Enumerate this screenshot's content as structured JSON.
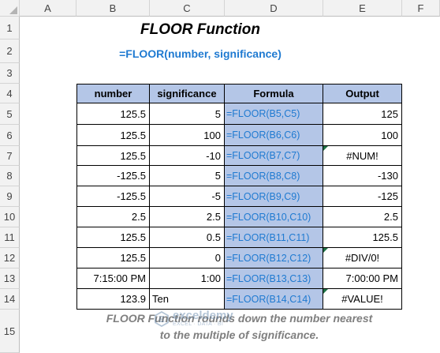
{
  "columns": [
    "A",
    "B",
    "C",
    "D",
    "E",
    "F"
  ],
  "rows": [
    "1",
    "2",
    "3",
    "4",
    "5",
    "6",
    "7",
    "8",
    "9",
    "10",
    "11",
    "12",
    "13",
    "14",
    "15"
  ],
  "title": "FLOOR Function",
  "syntax": "=FLOOR(number, significance)",
  "table": {
    "headers": [
      "number",
      "significance",
      "Formula",
      "Output"
    ],
    "rows": [
      [
        "125.5",
        "5",
        "=FLOOR(B5,C5)",
        "125"
      ],
      [
        "125.5",
        "100",
        "=FLOOR(B6,C6)",
        "100"
      ],
      [
        "125.5",
        "-10",
        "=FLOOR(B7,C7)",
        "#NUM!"
      ],
      [
        "-125.5",
        "5",
        "=FLOOR(B8,C8)",
        "-130"
      ],
      [
        "-125.5",
        "-5",
        "=FLOOR(B9,C9)",
        "-125"
      ],
      [
        "2.5",
        "2.5",
        "=FLOOR(B10,C10)",
        "2.5"
      ],
      [
        "125.5",
        "0.5",
        "=FLOOR(B11,C11)",
        "125.5"
      ],
      [
        "125.5",
        "0",
        "=FLOOR(B12,C12)",
        "#DIV/0!"
      ],
      [
        "7:15:00 PM",
        "1:00",
        "=FLOOR(B13,C13)",
        "7:00:00 PM"
      ],
      [
        "123.9",
        "Ten",
        "=FLOOR(B14,C14)",
        "#VALUE!"
      ]
    ]
  },
  "caption": {
    "line1": "FLOOR Function rounds down the number nearest",
    "line2": "to the multiple of significance."
  },
  "watermark": {
    "brand": "exceldemy",
    "tagline": "EXCEL · DATA · BI"
  },
  "colors": {
    "header_fill": "#b4c6e7",
    "formula_text": "#1f7ad1",
    "caption_text": "#7f7f7f",
    "error_indicator": "#1e7145"
  }
}
